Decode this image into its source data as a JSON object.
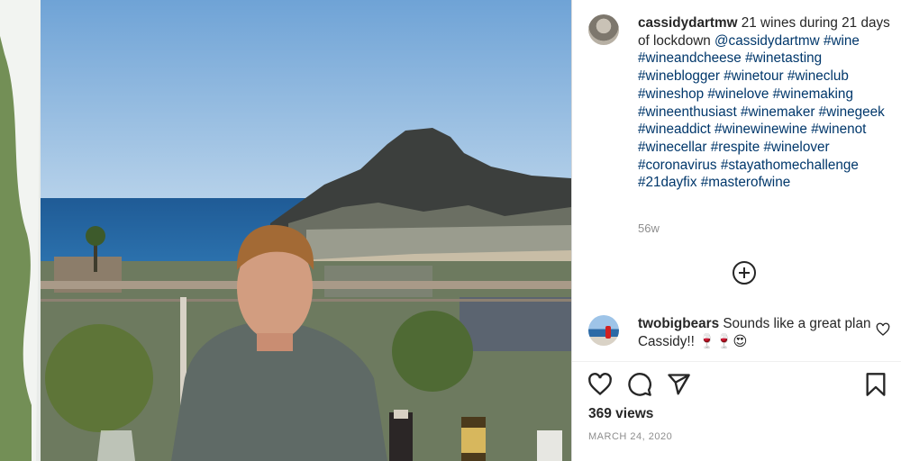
{
  "post": {
    "username": "cassidydartmw",
    "caption_text": "21 wines during 21 days of lockdown",
    "mention": "@cassidydartmw",
    "hashtags": [
      "#wine",
      "#wineandcheese",
      "#winetasting",
      "#wineblogger",
      "#winetour",
      "#wineclub",
      "#wineshop",
      "#winelove",
      "#winemaking",
      "#wineenthusiast",
      "#winemaker",
      "#winegeek",
      "#wineaddict",
      "#winewinewine",
      "#winenot",
      "#winecellar",
      "#respite",
      "#winelover",
      "#coronavirus",
      "#stayathomechallenge",
      "#21dayfix",
      "#masterofwine"
    ],
    "time_ago": "56w"
  },
  "comment": {
    "username": "twobigbears",
    "text": "Sounds like a great plan Cassidy!! 🍷🍷😍"
  },
  "stats": {
    "views": "369 views",
    "date": "MARCH 24, 2020"
  },
  "icons": {
    "like": "heart-outline-icon",
    "comment": "speech-bubble-icon",
    "share": "paper-plane-icon",
    "save": "bookmark-icon",
    "add_comment": "plus-circle-icon",
    "comment_like": "small-heart-icon"
  },
  "colors": {
    "text": "#262626",
    "hashtag": "#00376b",
    "secondary": "#8e8e8e",
    "divider": "#dbdbdb"
  }
}
